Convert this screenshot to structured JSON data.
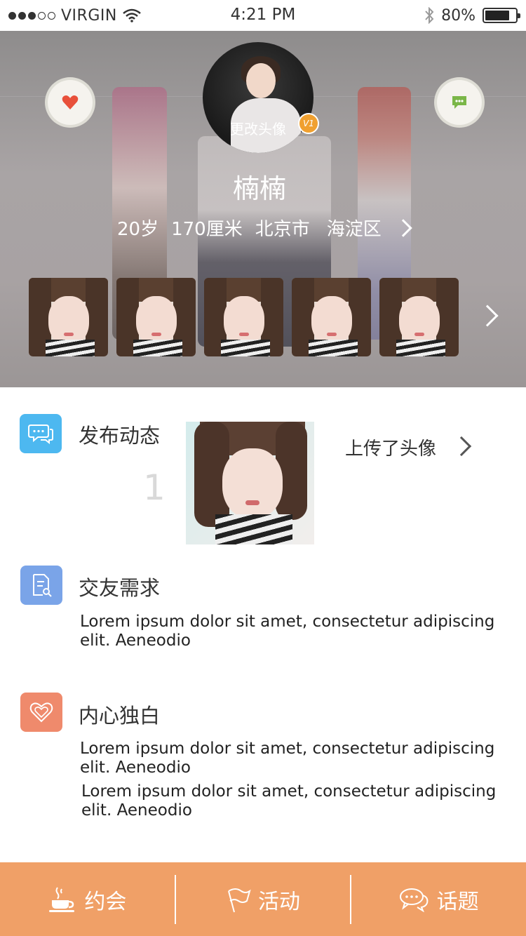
{
  "status_bar": {
    "carrier": "VIRGIN",
    "time": "4:21 PM",
    "battery": "80%",
    "battery_level": 0.8,
    "signal_dots_on": 3,
    "signal_dots_total": 5
  },
  "profile": {
    "change_avatar": "更改头像",
    "vip_badge": "V1",
    "name": "楠楠",
    "age": "20岁",
    "height": "170厘米",
    "city": "北京市",
    "district": "海淀区",
    "photo_count_shown": 5
  },
  "posts": {
    "title": "发布动态",
    "count": "1",
    "uploaded_text": "上传了头像"
  },
  "friend_request": {
    "title": "交友需求",
    "text": "Lorem ipsum dolor sit amet, consectetur adipiscing elit. Aeneodio"
  },
  "monologue": {
    "title": "内心独白",
    "text1": "Lorem ipsum dolor sit amet, consectetur adipiscing elit. Aeneodio",
    "text2": "Lorem ipsum dolor sit amet, consectetur adipiscing elit. Aeneodio"
  },
  "tabs": [
    {
      "label": "约会",
      "icon": "coffee-cup-icon"
    },
    {
      "label": "活动",
      "icon": "flag-icon"
    },
    {
      "label": "话题",
      "icon": "chat-bubbles-icon"
    }
  ],
  "colors": {
    "tab_bar": "#f0a067",
    "posts_icon": "#4db8f0",
    "friend_icon": "#7aa4e8",
    "monologue_icon": "#ef8a6c",
    "heart": "#e8503a",
    "chat": "#7ab648",
    "vip": "#f0a030"
  }
}
